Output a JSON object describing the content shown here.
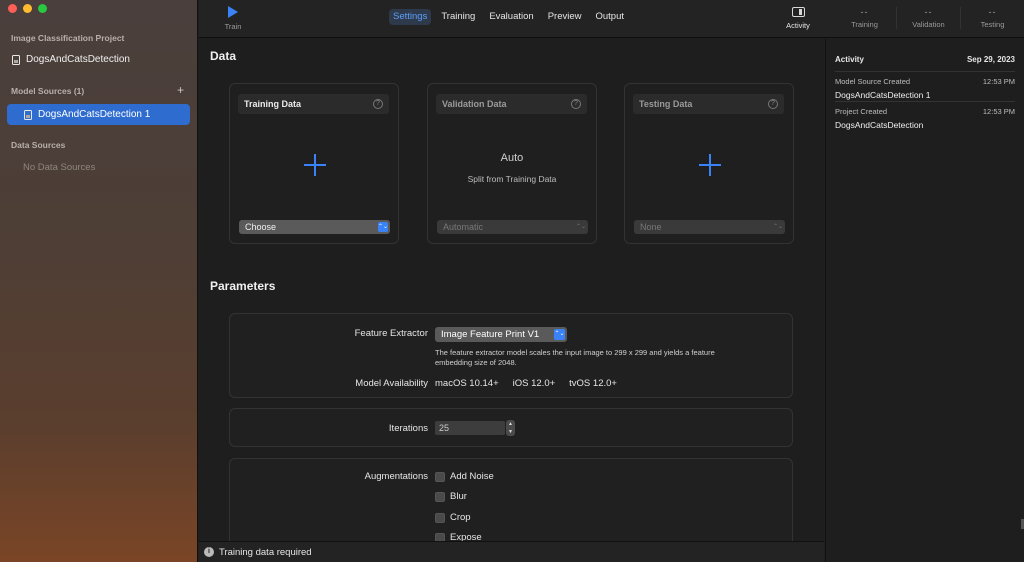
{
  "sidebar": {
    "project_header": "Image Classification Project",
    "project_name": "DogsAndCatsDetection",
    "model_sources_header": "Model Sources (1)",
    "add_label": "+",
    "model_source": "DogsAndCatsDetection 1",
    "data_sources_header": "Data Sources",
    "data_sources_empty": "No Data Sources"
  },
  "toolbar": {
    "train_label": "Train",
    "tabs": [
      "Settings",
      "Training",
      "Evaluation",
      "Preview",
      "Output"
    ],
    "active_tab": "Settings",
    "activity_label": "Activity",
    "stats": [
      {
        "value": "--",
        "label": "Training"
      },
      {
        "value": "--",
        "label": "Validation"
      },
      {
        "value": "--",
        "label": "Testing"
      }
    ]
  },
  "data_section": {
    "title": "Data",
    "training": {
      "title": "Training Data",
      "help": "?",
      "popup": "Choose",
      "arrow": "⌃⌄"
    },
    "validation": {
      "title": "Validation Data",
      "help": "?",
      "mode": "Auto",
      "subtitle": "Split from Training Data",
      "popup": "Automatic",
      "arrow": "⌃⌄"
    },
    "testing": {
      "title": "Testing Data",
      "help": "?",
      "popup": "None",
      "arrow": "⌃⌄"
    }
  },
  "parameters": {
    "title": "Parameters",
    "feature_extractor_label": "Feature Extractor",
    "feature_extractor_value": "Image Feature Print V1",
    "feature_extractor_desc": "The feature extractor model scales the input image to 299 x 299 and yields a feature embedding size of 2048.",
    "availability_label": "Model Availability",
    "availability": [
      "macOS 10.14+",
      "iOS 12.0+",
      "tvOS 12.0+"
    ],
    "iterations_label": "Iterations",
    "iterations_value": "25",
    "augmentations_label": "Augmentations",
    "augmentations": [
      "Add Noise",
      "Blur",
      "Crop",
      "Expose"
    ]
  },
  "status_bar": {
    "icon": "info-icon",
    "text": "Training data required"
  },
  "activity_panel": {
    "title": "Activity",
    "date": "Sep 29, 2023",
    "entries": [
      {
        "event": "Model Source Created",
        "time": "12:53 PM",
        "name": "DogsAndCatsDetection 1"
      },
      {
        "event": "Project Created",
        "time": "12:53 PM",
        "name": "DogsAndCatsDetection"
      }
    ]
  },
  "colors": {
    "accent": "#3a82f7",
    "selection": "#2f6cd0"
  }
}
